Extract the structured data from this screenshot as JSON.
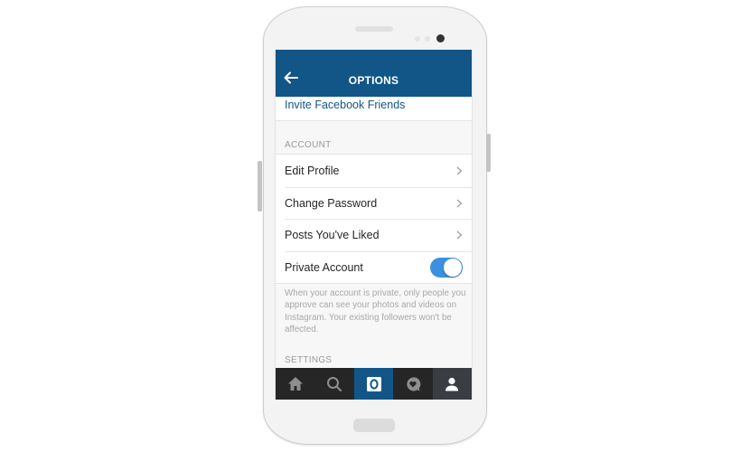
{
  "header": {
    "title": "OPTIONS",
    "back_icon": "arrow-left-icon"
  },
  "invite": {
    "label": "Invite Facebook Friends"
  },
  "sections": {
    "account_label": "ACCOUNT",
    "settings_label": "SETTINGS"
  },
  "account_items": [
    {
      "label": "Edit Profile",
      "icon": "chevron-right-icon"
    },
    {
      "label": "Change Password",
      "icon": "chevron-right-icon"
    },
    {
      "label": "Posts You've Liked",
      "icon": "chevron-right-icon"
    },
    {
      "label": "Private Account",
      "toggle": true
    }
  ],
  "private_account": {
    "enabled": true,
    "description": "When your account is private, only people you approve can see your photos and videos on Instagram. Your existing followers won't be affected."
  },
  "tabbar": {
    "tabs": [
      {
        "name": "home",
        "icon": "home-icon"
      },
      {
        "name": "search",
        "icon": "search-icon"
      },
      {
        "name": "camera",
        "icon": "camera-icon",
        "active": true
      },
      {
        "name": "activity",
        "icon": "heart-bubble-icon"
      },
      {
        "name": "profile",
        "icon": "person-icon",
        "selected": true
      }
    ]
  },
  "colors": {
    "brand": "#125688",
    "toggle_on": "#3d8fe0",
    "tabbar": "#262626"
  }
}
